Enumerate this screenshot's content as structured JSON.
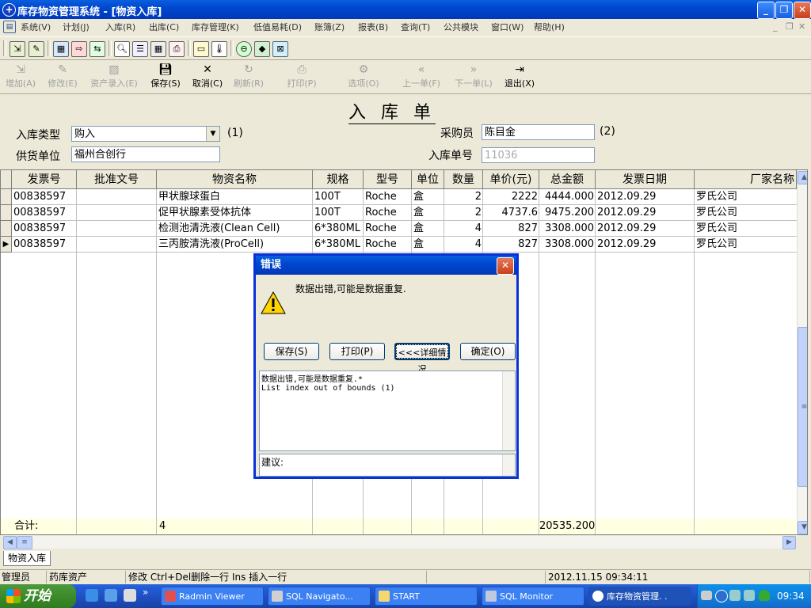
{
  "window": {
    "title": "库存物资管理系统 - [物资入库]",
    "app_icon": "plus"
  },
  "menu": [
    "系统(V)",
    "计划(J)",
    "入库(R)",
    "出库(C)",
    "库存管理(K)",
    "低值易耗(D)",
    "账簿(Z)",
    "报表(B)",
    "查询(T)",
    "公共模块",
    "窗口(W)",
    "帮助(H)"
  ],
  "actions": {
    "add": "增加(A)",
    "edit": "修改(E)",
    "asset_entry": "资产录入(E)",
    "save": "保存(S)",
    "cancel": "取消(C)",
    "refresh": "刷新(R)",
    "print": "打印(P)",
    "options": "选项(O)",
    "prev": "上一单(F)",
    "next": "下一单(L)",
    "exit": "退出(X)"
  },
  "form": {
    "title": "入 库 单",
    "type_label": "入库类型",
    "type_value": "购入",
    "type_hint": "(1)",
    "supplier_label": "供货单位",
    "supplier_value": "福州合创行",
    "buyer_label": "采购员",
    "buyer_value": "陈目金",
    "buyer_hint": "(2)",
    "order_label": "入库单号",
    "order_value": "11036"
  },
  "grid": {
    "columns": [
      "发票号",
      "批准文号",
      "物资名称",
      "规格",
      "型号",
      "单位",
      "数量",
      "单价(元)",
      "总金额",
      "发票日期",
      "厂家名称"
    ],
    "rows": [
      [
        "00838597",
        "",
        "甲状腺球蛋白",
        "100T",
        "Roche",
        "盒",
        "2",
        "2222",
        "4444.000",
        "2012.09.29",
        "罗氏公司"
      ],
      [
        "00838597",
        "",
        "促甲状腺素受体抗体",
        "100T",
        "Roche",
        "盒",
        "2",
        "4737.6",
        "9475.200",
        "2012.09.29",
        "罗氏公司"
      ],
      [
        "00838597",
        "",
        "检测池清洗液(Clean Cell)",
        "6*380ML",
        "Roche",
        "盒",
        "4",
        "827",
        "3308.000",
        "2012.09.29",
        "罗氏公司"
      ],
      [
        "00838597",
        "",
        "三丙胺清洗液(ProCell)",
        "6*380ML",
        "Roche",
        "盒",
        "4",
        "827",
        "3308.000",
        "2012.09.29",
        "罗氏公司"
      ]
    ],
    "current_row_marker": "▶",
    "total_label": "合计:",
    "total_count": "4",
    "total_amount": "20535.200"
  },
  "tab": "物资入库",
  "status": {
    "user": "管理员",
    "dept": "药库资产",
    "hint": "修改 Ctrl+Del删除一行  Ins 插入一行",
    "datetime": "2012.11.15 09:34:11"
  },
  "taskbar": {
    "start": "开始",
    "tasks": [
      "Radmin Viewer",
      "SQL Navigato...",
      "START",
      "SQL Monitor",
      "库存物资管理. ."
    ],
    "clock": "09:34"
  },
  "dialog": {
    "title": "错误",
    "message": "数据出错,可能是数据重复.",
    "buttons": [
      "保存(S)",
      "打印(P)",
      "<<<详细情况",
      "确定(O)"
    ],
    "details": [
      "数据出错,可能是数据重复.*",
      "List index out of bounds (1)"
    ],
    "suggestion_label": "建议:"
  }
}
